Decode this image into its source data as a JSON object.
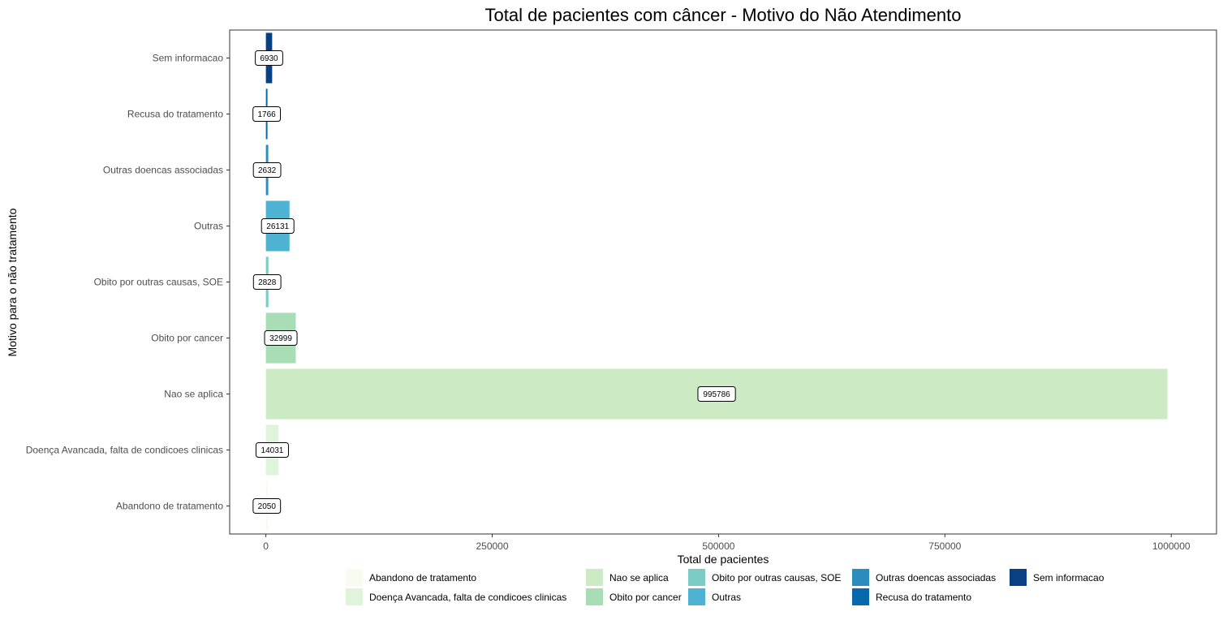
{
  "chart_data": {
    "type": "bar",
    "orientation": "horizontal",
    "title": "Total de pacientes com câncer - Motivo do Não Atendimento",
    "xlabel": "Total de pacientes",
    "ylabel": "Motivo para o não tratamento",
    "xlim": [
      -40000,
      1050000
    ],
    "xticks": [
      0,
      250000,
      500000,
      750000,
      1000000
    ],
    "xtick_labels": [
      "0",
      "250000",
      "500000",
      "750000",
      "1000000"
    ],
    "grid": false,
    "legend_position": "bottom",
    "categories": [
      "Abandono de tratamento",
      "Doença Avancada, falta de condicoes clinicas",
      "Nao se aplica",
      "Obito por cancer",
      "Obito por outras causas, SOE",
      "Outras",
      "Outras doencas associadas",
      "Recusa do tratamento",
      "Sem informacao"
    ],
    "values": [
      2050,
      14031,
      995786,
      32999,
      2828,
      26131,
      2632,
      1766,
      6930
    ],
    "colors": [
      "#f7fcf0",
      "#e0f3db",
      "#ccebc5",
      "#a8ddb5",
      "#7bccc4",
      "#4eb3d3",
      "#2b8cbe",
      "#0868ac",
      "#084081"
    ]
  }
}
